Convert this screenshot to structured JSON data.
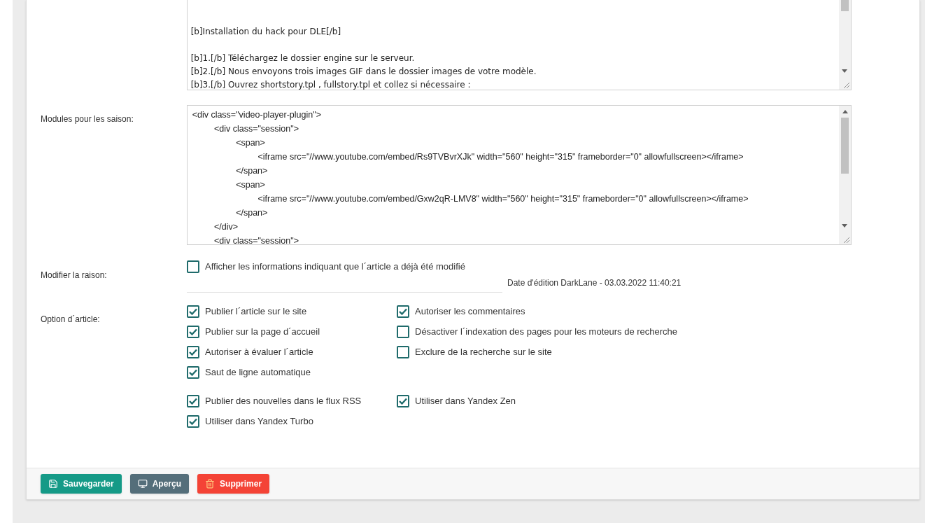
{
  "short_story": {
    "value": "\n\n\n[b]Installation du hack pour DLE[/b]\n\n[b]1.[/b] Téléchargez le dossier engine sur le serveur.\n[b]2.[/b] Nous envoyons trois images GIF dans le dossier images de votre modèle.\n[b]3.[/b] Ouvrez shortstory.tpl , fullstory.tpl et collez si nécessaire :"
  },
  "season_modules": {
    "label": "Modules pour les saison:",
    "value": "<div class=\"video-player-plugin\">\n\t<div class=\"session\">\n\t\t<span>\n\t\t\t<iframe src=\"//www.youtube.com/embed/Rs9TVBvrXJk\" width=\"560\" height=\"315\" frameborder=\"0\" allowfullscreen></iframe>\n\t\t</span>\n\t\t<span>\n\t\t\t<iframe src=\"//www.youtube.com/embed/Gxw2qR-LMV8\" width=\"560\" height=\"315\" frameborder=\"0\" allowfullscreen></iframe>\n\t\t</span>\n\t</div>\n\t<div class=\"session\">"
  },
  "edit_reason": {
    "label": "Modifier la raison:",
    "option": {
      "label": "Afficher les informations indiquant que l´article a déjà été modifié",
      "checked": false
    },
    "edit_info": "Date d'édition DarkLane - 03.03.2022 11:40:21"
  },
  "article_options": {
    "label": "Option d´article:",
    "groups": [
      {
        "left": [
          {
            "label": "Publier l´article sur le site",
            "checked": true
          },
          {
            "label": "Publier sur la page d´accueil",
            "checked": true
          },
          {
            "label": "Autoriser à évaluer l´article",
            "checked": true
          },
          {
            "label": "Saut de ligne automatique",
            "checked": true
          }
        ],
        "right": [
          {
            "label": "Autoriser les commentaires",
            "checked": true
          },
          {
            "label": "Désactiver l´indexation des pages pour les moteurs de recherche",
            "checked": false
          },
          {
            "label": "Exclure de la recherche sur le site",
            "checked": false
          }
        ]
      },
      {
        "left": [
          {
            "label": "Publier des nouvelles dans le flux RSS",
            "checked": true
          },
          {
            "label": "Utiliser dans Yandex Turbo",
            "checked": true
          }
        ],
        "right": [
          {
            "label": "Utiliser dans Yandex Zen",
            "checked": true
          }
        ]
      }
    ]
  },
  "buttons": [
    {
      "label": "Sauvegarder",
      "kind": "save"
    },
    {
      "label": "Aperçu",
      "kind": "preview"
    },
    {
      "label": "Supprimer",
      "kind": "delete"
    }
  ]
}
